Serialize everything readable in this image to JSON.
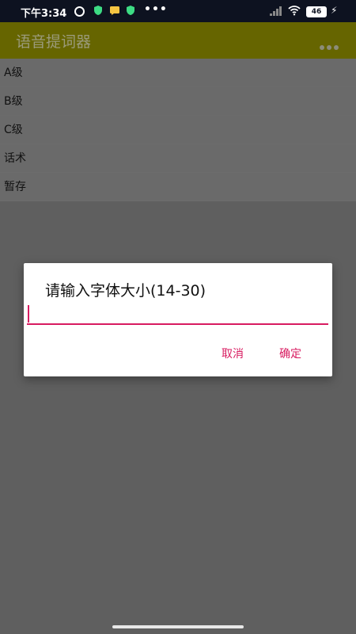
{
  "status_bar": {
    "time": "下午3:34",
    "dots": "•••",
    "battery": "46",
    "icons": [
      "alarm-icon",
      "shield-icon",
      "message-icon",
      "shield-icon",
      "signal-icon",
      "wifi-icon",
      "battery-icon",
      "charging-icon"
    ]
  },
  "app_bar": {
    "title": "语音提词器",
    "color": "#666500"
  },
  "list": {
    "items": [
      "A级",
      "B级",
      "C级",
      "话术",
      "暂存"
    ]
  },
  "dialog": {
    "title": "请输入字体大小(14-30)",
    "input_value": "",
    "cancel_label": "取消",
    "ok_label": "确定",
    "accent_color": "#d81b60"
  }
}
